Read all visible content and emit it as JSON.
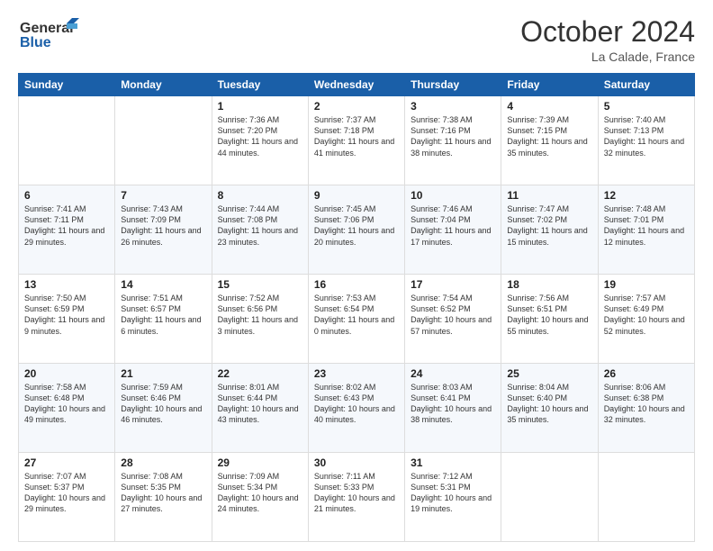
{
  "header": {
    "logo_line1": "General",
    "logo_line2": "Blue",
    "month": "October 2024",
    "location": "La Calade, France"
  },
  "weekdays": [
    "Sunday",
    "Monday",
    "Tuesday",
    "Wednesday",
    "Thursday",
    "Friday",
    "Saturday"
  ],
  "weeks": [
    [
      {
        "day": "",
        "info": ""
      },
      {
        "day": "",
        "info": ""
      },
      {
        "day": "1",
        "sunrise": "Sunrise: 7:36 AM",
        "sunset": "Sunset: 7:20 PM",
        "daylight": "Daylight: 11 hours and 44 minutes."
      },
      {
        "day": "2",
        "sunrise": "Sunrise: 7:37 AM",
        "sunset": "Sunset: 7:18 PM",
        "daylight": "Daylight: 11 hours and 41 minutes."
      },
      {
        "day": "3",
        "sunrise": "Sunrise: 7:38 AM",
        "sunset": "Sunset: 7:16 PM",
        "daylight": "Daylight: 11 hours and 38 minutes."
      },
      {
        "day": "4",
        "sunrise": "Sunrise: 7:39 AM",
        "sunset": "Sunset: 7:15 PM",
        "daylight": "Daylight: 11 hours and 35 minutes."
      },
      {
        "day": "5",
        "sunrise": "Sunrise: 7:40 AM",
        "sunset": "Sunset: 7:13 PM",
        "daylight": "Daylight: 11 hours and 32 minutes."
      }
    ],
    [
      {
        "day": "6",
        "sunrise": "Sunrise: 7:41 AM",
        "sunset": "Sunset: 7:11 PM",
        "daylight": "Daylight: 11 hours and 29 minutes."
      },
      {
        "day": "7",
        "sunrise": "Sunrise: 7:43 AM",
        "sunset": "Sunset: 7:09 PM",
        "daylight": "Daylight: 11 hours and 26 minutes."
      },
      {
        "day": "8",
        "sunrise": "Sunrise: 7:44 AM",
        "sunset": "Sunset: 7:08 PM",
        "daylight": "Daylight: 11 hours and 23 minutes."
      },
      {
        "day": "9",
        "sunrise": "Sunrise: 7:45 AM",
        "sunset": "Sunset: 7:06 PM",
        "daylight": "Daylight: 11 hours and 20 minutes."
      },
      {
        "day": "10",
        "sunrise": "Sunrise: 7:46 AM",
        "sunset": "Sunset: 7:04 PM",
        "daylight": "Daylight: 11 hours and 17 minutes."
      },
      {
        "day": "11",
        "sunrise": "Sunrise: 7:47 AM",
        "sunset": "Sunset: 7:02 PM",
        "daylight": "Daylight: 11 hours and 15 minutes."
      },
      {
        "day": "12",
        "sunrise": "Sunrise: 7:48 AM",
        "sunset": "Sunset: 7:01 PM",
        "daylight": "Daylight: 11 hours and 12 minutes."
      }
    ],
    [
      {
        "day": "13",
        "sunrise": "Sunrise: 7:50 AM",
        "sunset": "Sunset: 6:59 PM",
        "daylight": "Daylight: 11 hours and 9 minutes."
      },
      {
        "day": "14",
        "sunrise": "Sunrise: 7:51 AM",
        "sunset": "Sunset: 6:57 PM",
        "daylight": "Daylight: 11 hours and 6 minutes."
      },
      {
        "day": "15",
        "sunrise": "Sunrise: 7:52 AM",
        "sunset": "Sunset: 6:56 PM",
        "daylight": "Daylight: 11 hours and 3 minutes."
      },
      {
        "day": "16",
        "sunrise": "Sunrise: 7:53 AM",
        "sunset": "Sunset: 6:54 PM",
        "daylight": "Daylight: 11 hours and 0 minutes."
      },
      {
        "day": "17",
        "sunrise": "Sunrise: 7:54 AM",
        "sunset": "Sunset: 6:52 PM",
        "daylight": "Daylight: 10 hours and 57 minutes."
      },
      {
        "day": "18",
        "sunrise": "Sunrise: 7:56 AM",
        "sunset": "Sunset: 6:51 PM",
        "daylight": "Daylight: 10 hours and 55 minutes."
      },
      {
        "day": "19",
        "sunrise": "Sunrise: 7:57 AM",
        "sunset": "Sunset: 6:49 PM",
        "daylight": "Daylight: 10 hours and 52 minutes."
      }
    ],
    [
      {
        "day": "20",
        "sunrise": "Sunrise: 7:58 AM",
        "sunset": "Sunset: 6:48 PM",
        "daylight": "Daylight: 10 hours and 49 minutes."
      },
      {
        "day": "21",
        "sunrise": "Sunrise: 7:59 AM",
        "sunset": "Sunset: 6:46 PM",
        "daylight": "Daylight: 10 hours and 46 minutes."
      },
      {
        "day": "22",
        "sunrise": "Sunrise: 8:01 AM",
        "sunset": "Sunset: 6:44 PM",
        "daylight": "Daylight: 10 hours and 43 minutes."
      },
      {
        "day": "23",
        "sunrise": "Sunrise: 8:02 AM",
        "sunset": "Sunset: 6:43 PM",
        "daylight": "Daylight: 10 hours and 40 minutes."
      },
      {
        "day": "24",
        "sunrise": "Sunrise: 8:03 AM",
        "sunset": "Sunset: 6:41 PM",
        "daylight": "Daylight: 10 hours and 38 minutes."
      },
      {
        "day": "25",
        "sunrise": "Sunrise: 8:04 AM",
        "sunset": "Sunset: 6:40 PM",
        "daylight": "Daylight: 10 hours and 35 minutes."
      },
      {
        "day": "26",
        "sunrise": "Sunrise: 8:06 AM",
        "sunset": "Sunset: 6:38 PM",
        "daylight": "Daylight: 10 hours and 32 minutes."
      }
    ],
    [
      {
        "day": "27",
        "sunrise": "Sunrise: 7:07 AM",
        "sunset": "Sunset: 5:37 PM",
        "daylight": "Daylight: 10 hours and 29 minutes."
      },
      {
        "day": "28",
        "sunrise": "Sunrise: 7:08 AM",
        "sunset": "Sunset: 5:35 PM",
        "daylight": "Daylight: 10 hours and 27 minutes."
      },
      {
        "day": "29",
        "sunrise": "Sunrise: 7:09 AM",
        "sunset": "Sunset: 5:34 PM",
        "daylight": "Daylight: 10 hours and 24 minutes."
      },
      {
        "day": "30",
        "sunrise": "Sunrise: 7:11 AM",
        "sunset": "Sunset: 5:33 PM",
        "daylight": "Daylight: 10 hours and 21 minutes."
      },
      {
        "day": "31",
        "sunrise": "Sunrise: 7:12 AM",
        "sunset": "Sunset: 5:31 PM",
        "daylight": "Daylight: 10 hours and 19 minutes."
      },
      {
        "day": "",
        "info": ""
      },
      {
        "day": "",
        "info": ""
      }
    ]
  ]
}
